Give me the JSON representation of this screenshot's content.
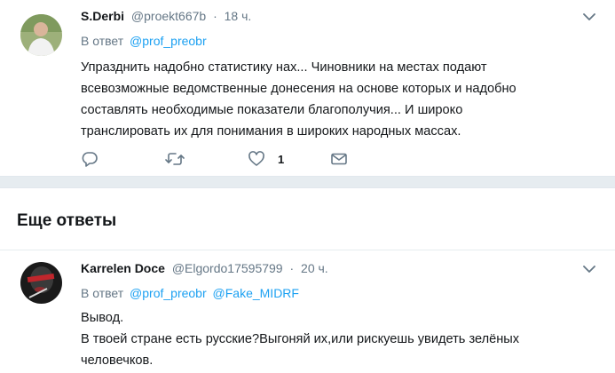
{
  "tweet1": {
    "name": "S.Derbi",
    "handle": "@proekt667b",
    "dot": "·",
    "time": "18 ч.",
    "reply_prefix": "В ответ",
    "reply_to": "@prof_preobr",
    "text_lines": [
      "Упразднить надобно статистику нах... Чиновники на местах подают",
      "всевозможные ведомственные донесения на основе которых и надобно",
      "составлять необходимые показатели благополучия... И широко",
      "транслировать их для понимания в широких народных массах."
    ],
    "like_count": "1"
  },
  "section": {
    "title": "Еще ответы"
  },
  "tweet2": {
    "name": "Karrelen Doce",
    "handle": "@Elgordo17595799",
    "dot": "·",
    "time": "20 ч.",
    "reply_prefix": "В ответ",
    "reply_to_1": "@prof_preobr",
    "reply_to_2": "@Fake_MIDRF",
    "text_lines": [
      "Вывод.",
      "В твоей стране есть русские?Выгоняй их,или рискуешь увидеть зелёных",
      "человечков."
    ]
  },
  "colors": {
    "accent": "#1da1f2",
    "muted": "#657786",
    "band": "#e6ecf0"
  },
  "icons": [
    "reply-icon",
    "retweet-icon",
    "heart-icon",
    "message-icon",
    "chevron-down-icon"
  ]
}
